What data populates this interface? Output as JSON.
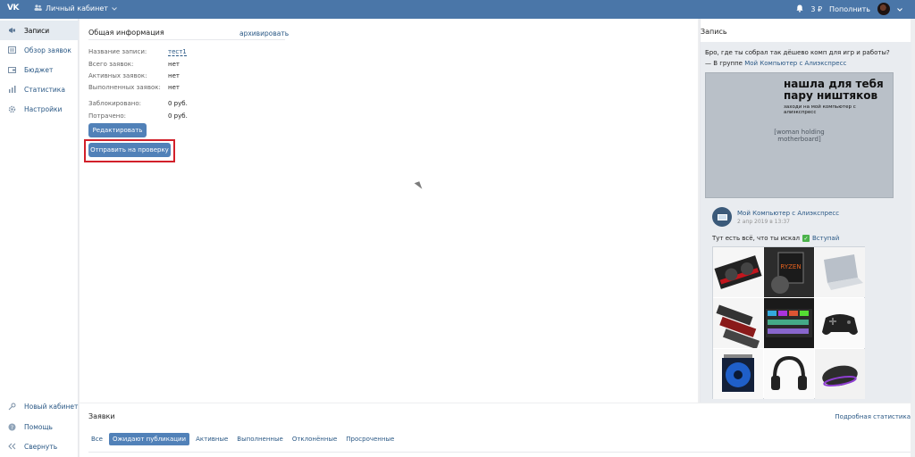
{
  "topbar": {
    "logo": "VK",
    "cabinet_title": "Личный кабинет",
    "balance": "3 ₽",
    "topup_label": "Пополнить",
    "brand_color": "#4a76a8"
  },
  "sidebar": {
    "items": [
      {
        "label": "Записи",
        "icon": "megaphone-icon"
      },
      {
        "label": "Обзор заявок",
        "icon": "list-icon"
      },
      {
        "label": "Бюджет",
        "icon": "wallet-icon"
      },
      {
        "label": "Статистика",
        "icon": "chart-icon"
      },
      {
        "label": "Настройки",
        "icon": "gear-icon"
      }
    ],
    "bottom_items": [
      {
        "label": "Новый кабинет",
        "icon": "key-icon"
      },
      {
        "label": "Помощь",
        "icon": "help-icon"
      },
      {
        "label": "Свернуть",
        "icon": "collapse-icon"
      }
    ]
  },
  "main": {
    "section_title": "Общая информация",
    "archive_label": "архивировать",
    "fields": [
      {
        "label": "Название записи:",
        "value": "тест1"
      },
      {
        "label": "Всего заявок:",
        "value": "нет"
      },
      {
        "label": "Активных заявок:",
        "value": "нет"
      },
      {
        "label": "Выполненных заявок:",
        "value": "нет"
      },
      {
        "label": "Заблокировано:",
        "value": "0 руб."
      },
      {
        "label": "Потрачено:",
        "value": "0 руб."
      }
    ],
    "edit_button": "Редактировать",
    "submit_button": "Отправить на проверку",
    "highlight_color": "#d2202a"
  },
  "card": {
    "title": "Запись",
    "ad_line1": "Бро, где ты собрал так дёшево комп для игр и работы?",
    "ad_line2_prefix": "— В группе ",
    "ad_group": "Мой Компьютер с Алиэкспресс",
    "image_placeholder": "[woman holding motherboard]",
    "image_text_big": "нашла для тебя пару ништяков",
    "image_text_small": "заходи на мой компьютер с алиэкспресс",
    "brand_name": "Мой Компьютер с Алиэкспресс",
    "brand_date": "2 апр 2019 в 13:37",
    "caption": "Тут есть всё, что ты искал",
    "join_label": "Вступай",
    "grid_items": [
      "graphics-card",
      "ryzen-cpu",
      "laptop",
      "ram-module",
      "rgb-keyboard",
      "gamepad",
      "cpu-cooler",
      "headphones",
      "mouse"
    ]
  },
  "bottom": {
    "title": "Заявки",
    "stats_link": "Подробная статистика",
    "tabs": [
      "Все",
      "Ожидают публикации",
      "Активные",
      "Выполненные",
      "Отклонённые",
      "Просроченные"
    ],
    "active_tab_index": 1
  }
}
